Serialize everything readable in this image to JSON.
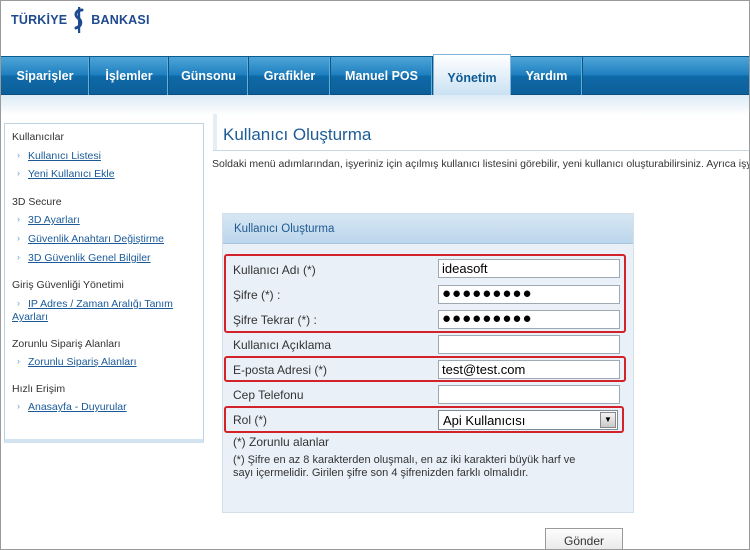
{
  "brand": {
    "left": "TÜRKİYE",
    "right": "BANKASI",
    "accent": "#1e4a8e"
  },
  "nav": {
    "items": [
      {
        "label": "Siparişler",
        "active": false
      },
      {
        "label": "İşlemler",
        "active": false
      },
      {
        "label": "Günsonu",
        "active": false
      },
      {
        "label": "Grafikler",
        "active": false
      },
      {
        "label": "Manuel POS",
        "active": false
      },
      {
        "label": "Yönetim",
        "active": true
      },
      {
        "label": "Yardım",
        "active": false
      }
    ]
  },
  "sidebar": {
    "groups": [
      {
        "title": "Kullanıcılar",
        "links": [
          "Kullanıcı Listesi",
          "Yeni Kullanıcı Ekle"
        ]
      },
      {
        "title": "3D Secure",
        "links": [
          "3D Ayarları",
          "Güvenlik Anahtarı Değiştirme",
          "3D Güvenlik Genel Bilgiler"
        ]
      },
      {
        "title": "Giriş Güvenliği Yönetimi",
        "links": [
          "IP Adres / Zaman Aralığı Tanım",
          "Ayarları"
        ]
      },
      {
        "title": "Zorunlu Sipariş Alanları",
        "links": [
          "Zorunlu Sipariş Alanları"
        ]
      },
      {
        "title": "Hızlı Erişim",
        "links": [
          "Anasayfa - Duyurular"
        ]
      }
    ]
  },
  "main": {
    "title": "Kullanıcı Oluşturma",
    "description": "Soldaki menü adımlarından, işyeriniz için açılmış kullanıcı listesini görebilir, yeni kullanıcı oluşturabilirsiniz. Ayrıca işye"
  },
  "form": {
    "header": "Kullanıcı Oluşturma",
    "fields": {
      "username": {
        "label": "Kullanıcı Adı (*)",
        "value": "ideasoft"
      },
      "password": {
        "label": "Şifre (*) :",
        "value": "●●●●●●●●●"
      },
      "password_repeat": {
        "label": "Şifre Tekrar (*) :",
        "value": "●●●●●●●●●"
      },
      "description": {
        "label": "Kullanıcı Açıklama",
        "value": ""
      },
      "email": {
        "label": "E-posta Adresi (*)",
        "value": "test@test.com"
      },
      "phone": {
        "label": "Cep Telefonu",
        "value": ""
      },
      "role": {
        "label": "Rol (*)",
        "value": "Api Kullanıcısı"
      }
    },
    "required_note": "(*) Zorunlu alanlar",
    "password_rule_line1": "(*) Şifre en az 8 karakterden oluşmalı, en az iki karakteri büyük harf ve",
    "password_rule_line2": "sayı içermelidir. Girilen şifre son 4 şifrenizden farklı olmalıdır.",
    "submit_label": "Gönder"
  },
  "colors": {
    "nav": "#1f7fbf",
    "highlight": "#d3222a",
    "title": "#1e5c96"
  }
}
